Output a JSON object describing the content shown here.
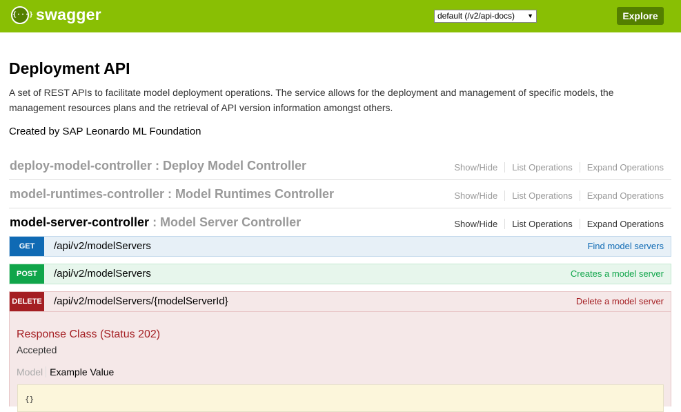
{
  "header": {
    "brand": "swagger",
    "logo_glyph": "{···}",
    "spec_select_value": "default (/v2/api-docs)",
    "explore_label": "Explore",
    "bar_color": "#89bf04"
  },
  "info": {
    "title": "Deployment API",
    "description": "A set of REST APIs to facilitate model deployment operations. The service allows for the deployment and management of specific models, the management resources plans and the retrieval of API version information amongst others.",
    "created_by": "Created by SAP Leonardo ML Foundation"
  },
  "resources": [
    {
      "name": "deploy-model-controller",
      "desc": " : Deploy Model Controller",
      "show_hide": "Show/Hide",
      "list_ops": "List Operations",
      "expand_ops": "Expand Operations"
    },
    {
      "name": "model-runtimes-controller",
      "desc": " : Model Runtimes Controller",
      "show_hide": "Show/Hide",
      "list_ops": "List Operations",
      "expand_ops": "Expand Operations"
    },
    {
      "name": "model-server-controller",
      "desc": " : Model Server Controller",
      "show_hide": "Show/Hide",
      "list_ops": "List Operations",
      "expand_ops": "Expand Operations"
    }
  ],
  "operations": [
    {
      "method": "GET",
      "path": "/api/v2/modelServers",
      "summary": "Find model servers",
      "color": "#0f6ab4"
    },
    {
      "method": "POST",
      "path": "/api/v2/modelServers",
      "summary": "Creates a model server",
      "color": "#10a54a"
    },
    {
      "method": "DELETE",
      "path": "/api/v2/modelServers/{modelServerId}",
      "summary": "Delete a model server",
      "color": "#a41e22"
    }
  ],
  "delete_details": {
    "response_class_title": "Response Class (Status 202)",
    "response_text": "Accepted",
    "tab_model": "Model",
    "tab_example": "Example Value",
    "example_code": "{}"
  }
}
